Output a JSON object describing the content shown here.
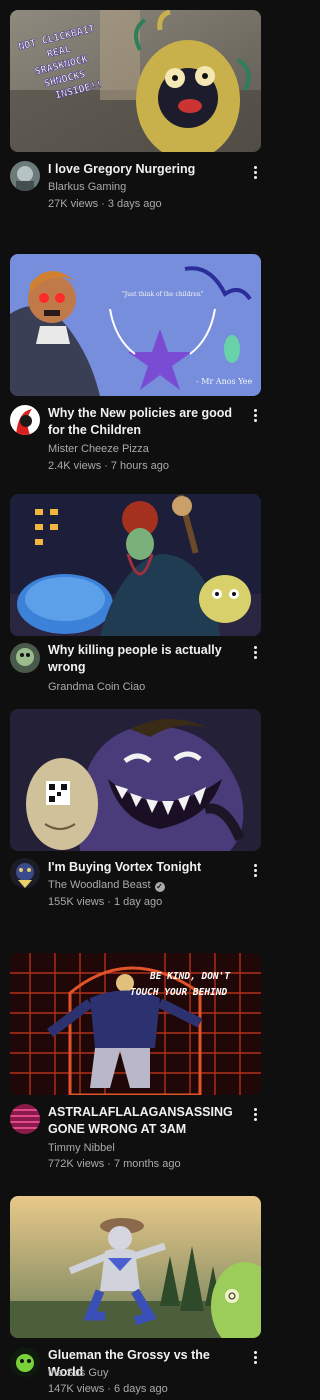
{
  "videos": [
    {
      "title": "I love Gregory Nurgering",
      "channel": "Blarkus Gaming",
      "views": "27K views",
      "age": "3 days ago",
      "thumb_text": [
        "NOT CLICKBAIT",
        "REAL",
        "SRASKNOCK",
        "SHNOCKS",
        "INSIDE!!"
      ],
      "thumb_icon": "monster-face-icon"
    },
    {
      "title": "Why the New policies are good for the Children",
      "channel": "Mister Cheeze Pizza",
      "views": "2.4K views",
      "age": "7 hours ago",
      "thumb_text": [
        "\"Just think of the children\"",
        "- Mr Anos Yee"
      ],
      "thumb_icon": "star-laurel-icon"
    },
    {
      "title": "Why killing people is actually wrong",
      "channel": "Grandma Coin Ciao",
      "views": "",
      "age": "",
      "thumb_icon": "night-scene-icon"
    },
    {
      "title": "I'm Buying Vortex Tonight",
      "channel": "The Woodland Beast",
      "views": "155K views",
      "age": "1 day ago",
      "verified": true,
      "thumb_icon": "grinning-shadow-icon"
    },
    {
      "title": "ASTRALAFLALAGANSASSING GONE WRONG AT 3AM",
      "channel": "Timmy Nibbel",
      "views": "772K views",
      "age": "7 months ago",
      "thumb_text": [
        "BE KIND, DON'T",
        "TOUCH YOUR BEHIND"
      ],
      "thumb_icon": "figure-at-gate-icon"
    },
    {
      "title": "Glueman the Grossy vs the World",
      "channel": "the Sus Guy",
      "views": "147K views",
      "age": "6 days ago",
      "thumb_icon": "dancing-figure-icon"
    }
  ],
  "colors": {
    "background": "#0f0f0f",
    "primary_text": "#f1f1f1",
    "secondary_text": "#aaaaaa"
  }
}
